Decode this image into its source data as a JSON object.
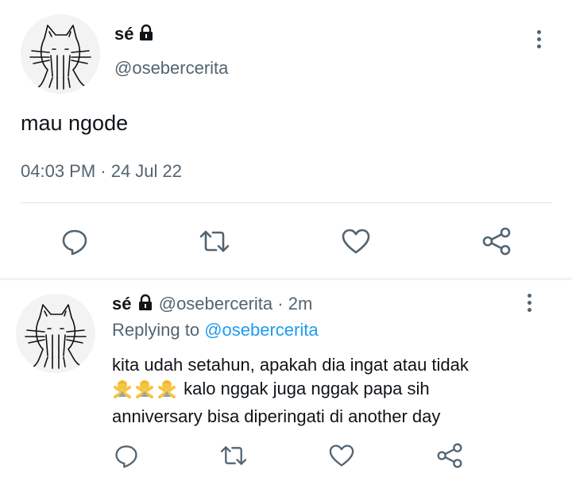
{
  "main_tweet": {
    "display_name": "sé",
    "handle": "@osebercerita",
    "text": "mau ngode",
    "timestamp": "04:03 PM · 24 Jul 22",
    "lock_icon": "lock-icon",
    "more_icon": "more-vertical-icon"
  },
  "actions": [
    {
      "icon": "reply-icon"
    },
    {
      "icon": "retweet-icon"
    },
    {
      "icon": "like-icon"
    },
    {
      "icon": "share-icon"
    }
  ],
  "reply_tweet": {
    "display_name": "sé",
    "handle": "@osebercerita",
    "time": "2m",
    "separator": "·",
    "replying_label": "Replying to",
    "replying_to": "@osebercerita",
    "line1": "kita udah setahun, apakah dia ingat atau tidak",
    "emoji": "🙅‍♂️🙅‍♂️🙅‍♂️",
    "line2": "kalo nggak juga nggak papa sih",
    "line3": "anniversary bisa diperingati di another day"
  },
  "colors": {
    "text": "#0f1419",
    "secondary": "#536471",
    "mention": "#1d9bf0",
    "divider": "#e1e6ea"
  }
}
